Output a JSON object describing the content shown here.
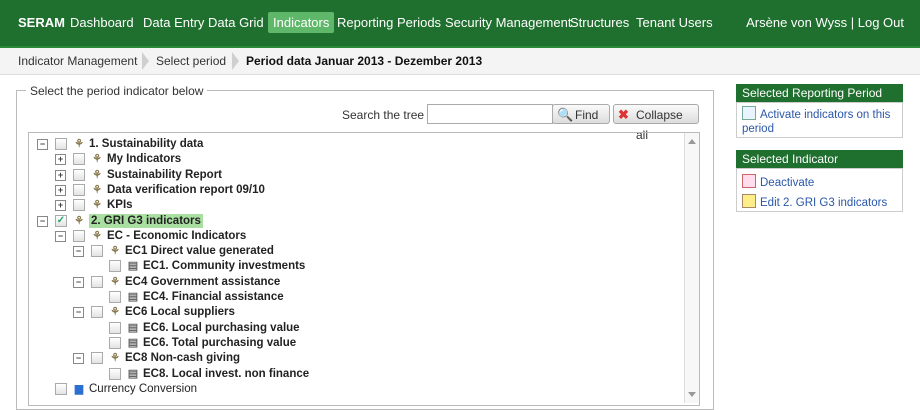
{
  "nav": {
    "brand": "SERAM",
    "items": [
      "Dashboard",
      "Data Entry",
      "Data Grid",
      "Indicators",
      "Reporting Periods",
      "Security Management",
      "Structures",
      "Tenant Users"
    ],
    "active": "Indicators",
    "user": "Arsène von Wyss | Log Out"
  },
  "breadcrumb": [
    "Indicator Management",
    "Select period",
    "Period data Januar 2013 - Dezember 2013"
  ],
  "panel": {
    "legend": "Select the period indicator below",
    "search_label": "Search the tree",
    "search_value": "",
    "find_label": "Find",
    "collapse_label": "Collapse all"
  },
  "tree": [
    {
      "label": "1. Sustainability data",
      "exp": "−",
      "checked": false,
      "icon": "tree-hierarchy-icon"
    },
    {
      "label": "My Indicators",
      "exp": "+",
      "checked": false,
      "icon": "tree-hierarchy-icon"
    },
    {
      "label": "Sustainability Report",
      "exp": "+",
      "checked": false,
      "icon": "tree-hierarchy-icon"
    },
    {
      "label": "Data verification report 09/10",
      "exp": "+",
      "checked": false,
      "icon": "tree-hierarchy-icon"
    },
    {
      "label": "KPIs",
      "exp": "+",
      "checked": false,
      "icon": "tree-hierarchy-icon"
    },
    {
      "label": "2. GRI G3 indicators",
      "exp": "−",
      "checked": true,
      "icon": "tree-hierarchy-icon",
      "selected": true
    },
    {
      "label": "EC - Economic Indicators",
      "exp": "−",
      "checked": false,
      "icon": "tree-hierarchy-icon"
    },
    {
      "label": "EC1 Direct value generated",
      "exp": "−",
      "checked": false,
      "icon": "tree-hierarchy-icon"
    },
    {
      "label": "EC1. Community investments",
      "exp": "",
      "checked": false,
      "icon": "indicator-sheet-icon"
    },
    {
      "label": "EC4 Government assistance",
      "exp": "−",
      "checked": false,
      "icon": "tree-hierarchy-icon"
    },
    {
      "label": "EC4. Financial assistance",
      "exp": "",
      "checked": false,
      "icon": "indicator-sheet-icon"
    },
    {
      "label": "EC6 Local suppliers",
      "exp": "−",
      "checked": false,
      "icon": "tree-hierarchy-icon"
    },
    {
      "label": "EC6. Local purchasing value",
      "exp": "",
      "checked": false,
      "icon": "indicator-sheet-icon"
    },
    {
      "label": "EC6. Total purchasing value",
      "exp": "",
      "checked": false,
      "icon": "indicator-sheet-icon"
    },
    {
      "label": "EC8 Non-cash giving",
      "exp": "−",
      "checked": false,
      "icon": "tree-hierarchy-icon"
    },
    {
      "label": "EC8. Local invest. non finance",
      "exp": "",
      "checked": false,
      "icon": "indicator-sheet-icon"
    },
    {
      "label": "Currency Conversion",
      "exp": "",
      "checked": false,
      "icon": "bar-chart-icon",
      "plain": true
    }
  ],
  "sidebar": {
    "period_title": "Selected Reporting Period",
    "period_link": "Activate indicators on this period",
    "indicator_title": "Selected Indicator",
    "deactivate": "Deactivate",
    "edit": "Edit 2. GRI G3 indicators"
  },
  "colors": {
    "nav": "#1f6f2e",
    "active": "#5fb86a",
    "highlight": "#a9dfa1",
    "link": "#2a57a8"
  }
}
